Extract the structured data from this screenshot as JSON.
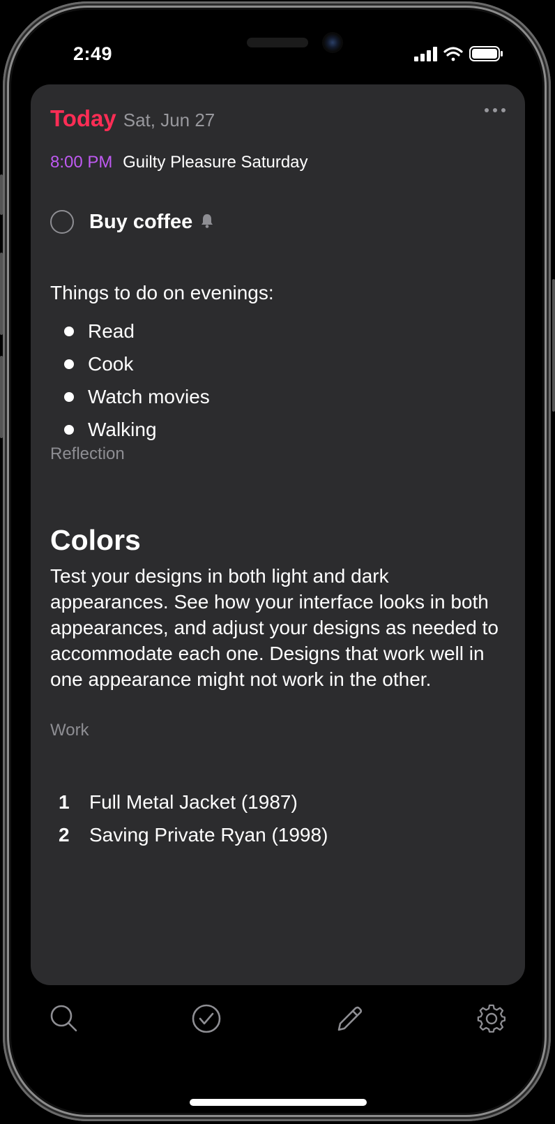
{
  "status_bar": {
    "time": "2:49"
  },
  "header": {
    "title": "Today",
    "date": "Sat, Jun 27"
  },
  "event": {
    "time": "8:00 PM",
    "title": "Guilty Pleasure Saturday"
  },
  "todo": {
    "label": "Buy coffee",
    "reminder": "bell-icon"
  },
  "note1": {
    "intro": "Things to do on evenings:",
    "items": [
      "Read",
      "Cook",
      "Watch movies",
      "Walking"
    ],
    "tag": "Reflection"
  },
  "note2": {
    "heading": "Colors",
    "paragraph": "Test your designs in both light and dark appearances. See how your interface looks in both appearances, and adjust your designs as needed to accommodate each one. Designs that work well in one appearance might not work in the other.",
    "tag": "Work"
  },
  "movies": {
    "items": [
      {
        "num": "1",
        "title": "Full Metal Jacket (1987)"
      },
      {
        "num": "2",
        "title": "Saving Private Ryan (1998)"
      }
    ]
  },
  "tabbar": {
    "icons": [
      "search-icon",
      "checkmark-circle-icon",
      "pencil-icon",
      "gear-icon"
    ]
  },
  "colors": {
    "accent_today": "#ff2d55",
    "event_time": "#bf5af2",
    "card_bg": "#2c2c2e"
  }
}
